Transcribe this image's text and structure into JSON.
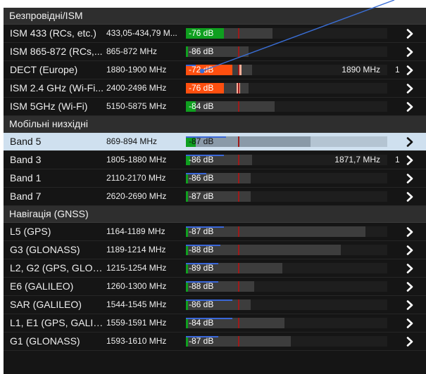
{
  "colors": {
    "green": "#0f9f1f",
    "orange": "#ff4f0f",
    "peak": "#ffb09a",
    "marker": "#9c1a1a",
    "blue": "#3a67d8",
    "selected": "#cfe0ef"
  },
  "icons": {
    "row_action": "chevron-right-icon",
    "annotation": "pointer-arrow"
  },
  "sections": [
    {
      "title": "Безпровідні/ISM",
      "rows": [
        {
          "name": "ISM 433 (RCs, etc.)",
          "freq": "433,05-434,79 M...",
          "db": "-76 dB",
          "level": 0.19,
          "track": 0.43,
          "blue": 0,
          "color": "green",
          "mark": "",
          "count": ""
        },
        {
          "name": "ISM 865-872 (RCs,...",
          "freq": "865-872 MHz",
          "db": "-86 dB",
          "level": 0.01,
          "track": 0.31,
          "blue": 0,
          "color": "green",
          "mark": "",
          "count": ""
        },
        {
          "name": "DECT (Europe)",
          "freq": "1880-1900 MHz",
          "db": "-72 dB",
          "level": 0.23,
          "track": 0.33,
          "blue": 0.05,
          "color": "orange",
          "peak": 0.26,
          "mark": "1890 MHz",
          "count": "1"
        },
        {
          "name": "ISM 2.4 GHz (Wi-Fi...",
          "freq": "2400-2496 MHz",
          "db": "-76 dB",
          "level": 0.19,
          "track": 0.31,
          "blue": 0,
          "color": "orange",
          "peak": 0.25,
          "mark": "",
          "count": ""
        },
        {
          "name": "ISM 5GHz (Wi-Fi)",
          "freq": "5150-5875 MHz",
          "db": "-84 dB",
          "level": 0.05,
          "track": 0.44,
          "blue": 0,
          "color": "green",
          "mark": "",
          "count": ""
        }
      ]
    },
    {
      "title": "Мобільні низхідні",
      "rows": [
        {
          "name": "Band 5",
          "freq": "869-894 MHz",
          "db": "-87 dB",
          "level": 0.05,
          "track": 0.62,
          "blue": 0.2,
          "color": "green",
          "mark": "",
          "count": "",
          "selected": true
        },
        {
          "name": "Band 3",
          "freq": "1805-1880 MHz",
          "db": "-86 dB",
          "level": 0.02,
          "track": 0.33,
          "blue": 0.19,
          "color": "green",
          "mark": "1871,7 MHz",
          "count": "1"
        },
        {
          "name": "Band 1",
          "freq": "2110-2170 MHz",
          "db": "-86 dB",
          "level": 0.01,
          "track": 0.32,
          "blue": 0.1,
          "color": "green",
          "mark": "",
          "count": ""
        },
        {
          "name": "Band 7",
          "freq": "2620-2690 MHz",
          "db": "-87 dB",
          "level": 0.01,
          "track": 0.32,
          "blue": 0,
          "color": "green",
          "mark": "",
          "count": ""
        }
      ]
    },
    {
      "title": "Навігація (GNSS)",
      "rows": [
        {
          "name": "L5 (GPS)",
          "freq": "1164-1189 MHz",
          "db": "-87 dB",
          "level": 0.01,
          "track": 0.89,
          "blue": 0.19,
          "color": "green",
          "mark": "",
          "count": ""
        },
        {
          "name": "G3 (GLONASS)",
          "freq": "1189-1214 MHz",
          "db": "-88 dB",
          "level": 0.01,
          "track": 0.77,
          "blue": 0.17,
          "color": "green",
          "mark": "",
          "count": ""
        },
        {
          "name": "L2, G2 (GPS, GLON...",
          "freq": "1215-1254 MHz",
          "db": "-89 dB",
          "level": 0.01,
          "track": 0.48,
          "blue": 0.16,
          "color": "green",
          "mark": "",
          "count": ""
        },
        {
          "name": "E6 (GALILEO)",
          "freq": "1260-1300 MHz",
          "db": "-88 dB",
          "level": 0.01,
          "track": 0.34,
          "blue": 0.16,
          "color": "green",
          "mark": "",
          "count": ""
        },
        {
          "name": "SAR (GALILEO)",
          "freq": "1544-1545 MHz",
          "db": "-86 dB",
          "level": 0.01,
          "track": 0.32,
          "blue": 0.23,
          "color": "green",
          "mark": "",
          "count": ""
        },
        {
          "name": "L1, E1 (GPS, GALILE...",
          "freq": "1559-1591 MHz",
          "db": "-84 dB",
          "level": 0.01,
          "track": 0.49,
          "blue": 0.23,
          "color": "green",
          "mark": "",
          "count": ""
        },
        {
          "name": "G1 (GLONASS)",
          "freq": "1593-1610 MHz",
          "db": "-87 dB",
          "level": 0.01,
          "track": 0.52,
          "blue": 0.16,
          "color": "green",
          "mark": "",
          "count": ""
        }
      ]
    }
  ]
}
